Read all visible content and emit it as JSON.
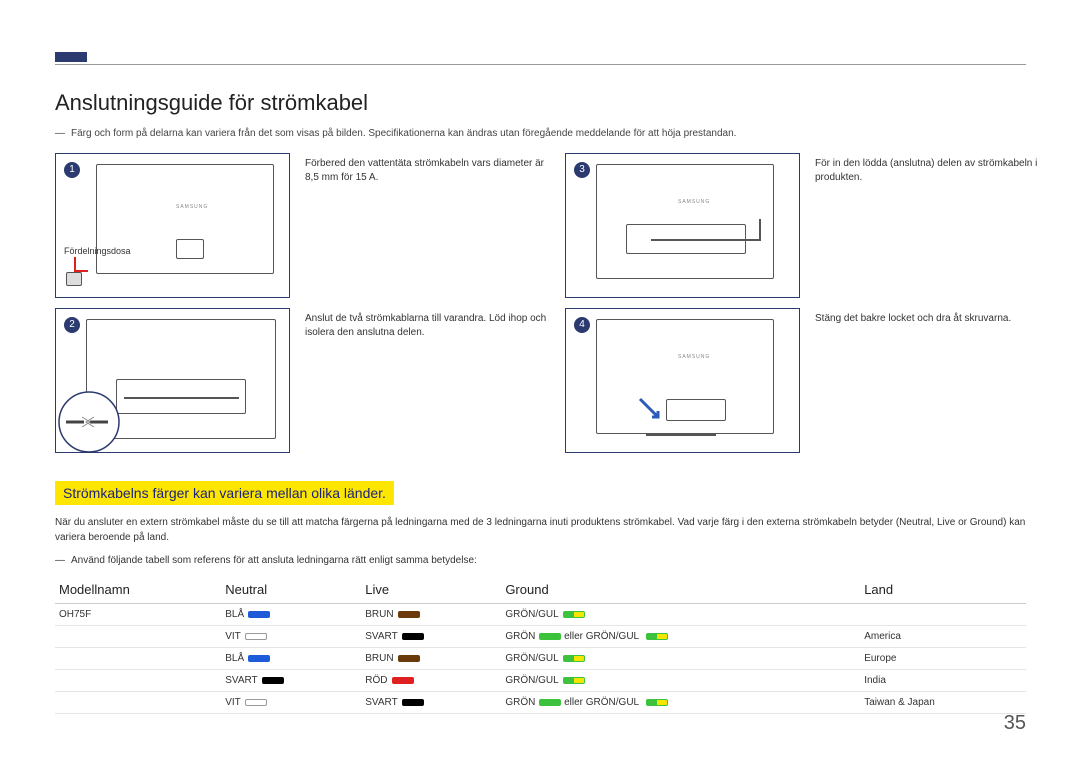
{
  "page_number": "35",
  "title": "Anslutningsguide för strömkabel",
  "intro_note": "Färg och form på delarna kan variera från det som visas på bilden. Specifikationerna kan ändras utan föregående meddelande för att höja prestandan.",
  "junction_box_label": "Fördelningsdosa",
  "steps": {
    "s1": {
      "num": "1",
      "text": "Förbered den vattentäta strömkabeln vars diameter är 8,5 mm för 15 A."
    },
    "s2": {
      "num": "2",
      "text": "Anslut de två strömkablarna till varandra. Löd ihop och isolera den anslutna delen."
    },
    "s3": {
      "num": "3",
      "text": "För in den lödda (anslutna) delen av strömkabeln i produkten."
    },
    "s4": {
      "num": "4",
      "text": "Stäng det bakre locket och dra åt skruvarna."
    }
  },
  "highlight_caption": "Strömkabelns färger kan variera mellan olika länder.",
  "body_para": "När du ansluter en extern strömkabel måste du se till att matcha färgerna på ledningarna med de 3 ledningarna inuti produktens strömkabel. Vad varje färg i den externa strömkabeln betyder (Neutral, Live or Ground) kan variera beroende på land.",
  "body_note": "Använd följande tabell som referens för att ansluta ledningarna rätt enligt samma betydelse:",
  "table": {
    "headers": {
      "model": "Modellnamn",
      "neutral": "Neutral",
      "live": "Live",
      "ground": "Ground",
      "land": "Land"
    },
    "rows": [
      {
        "model": "OH75F",
        "neutral": "BLÅ",
        "neutral_chip": "blue",
        "live": "BRUN",
        "live_chip": "brown",
        "ground_a": "GRÖN/GUL",
        "ground_a_chip": "greenyellow",
        "ground_b": "",
        "ground_b_chip": "",
        "land": ""
      },
      {
        "model": "",
        "neutral": "VIT",
        "neutral_chip": "white",
        "live": "SVART",
        "live_chip": "black",
        "ground_a": "GRÖN",
        "ground_a_chip": "green",
        "ground_b": "eller GRÖN/GUL",
        "ground_b_chip": "greenyellow",
        "land": "America"
      },
      {
        "model": "",
        "neutral": "BLÅ",
        "neutral_chip": "blue",
        "live": "BRUN",
        "live_chip": "brown",
        "ground_a": "GRÖN/GUL",
        "ground_a_chip": "greenyellow",
        "ground_b": "",
        "ground_b_chip": "",
        "land": "Europe"
      },
      {
        "model": "",
        "neutral": "SVART",
        "neutral_chip": "black",
        "live": "RÖD",
        "live_chip": "red",
        "ground_a": "GRÖN/GUL",
        "ground_a_chip": "greenyellow",
        "ground_b": "",
        "ground_b_chip": "",
        "land": "India"
      },
      {
        "model": "",
        "neutral": "VIT",
        "neutral_chip": "white",
        "live": "SVART",
        "live_chip": "black",
        "ground_a": "GRÖN",
        "ground_a_chip": "green",
        "ground_b": "eller GRÖN/GUL",
        "ground_b_chip": "greenyellow",
        "land": "Taiwan & Japan"
      }
    ]
  }
}
